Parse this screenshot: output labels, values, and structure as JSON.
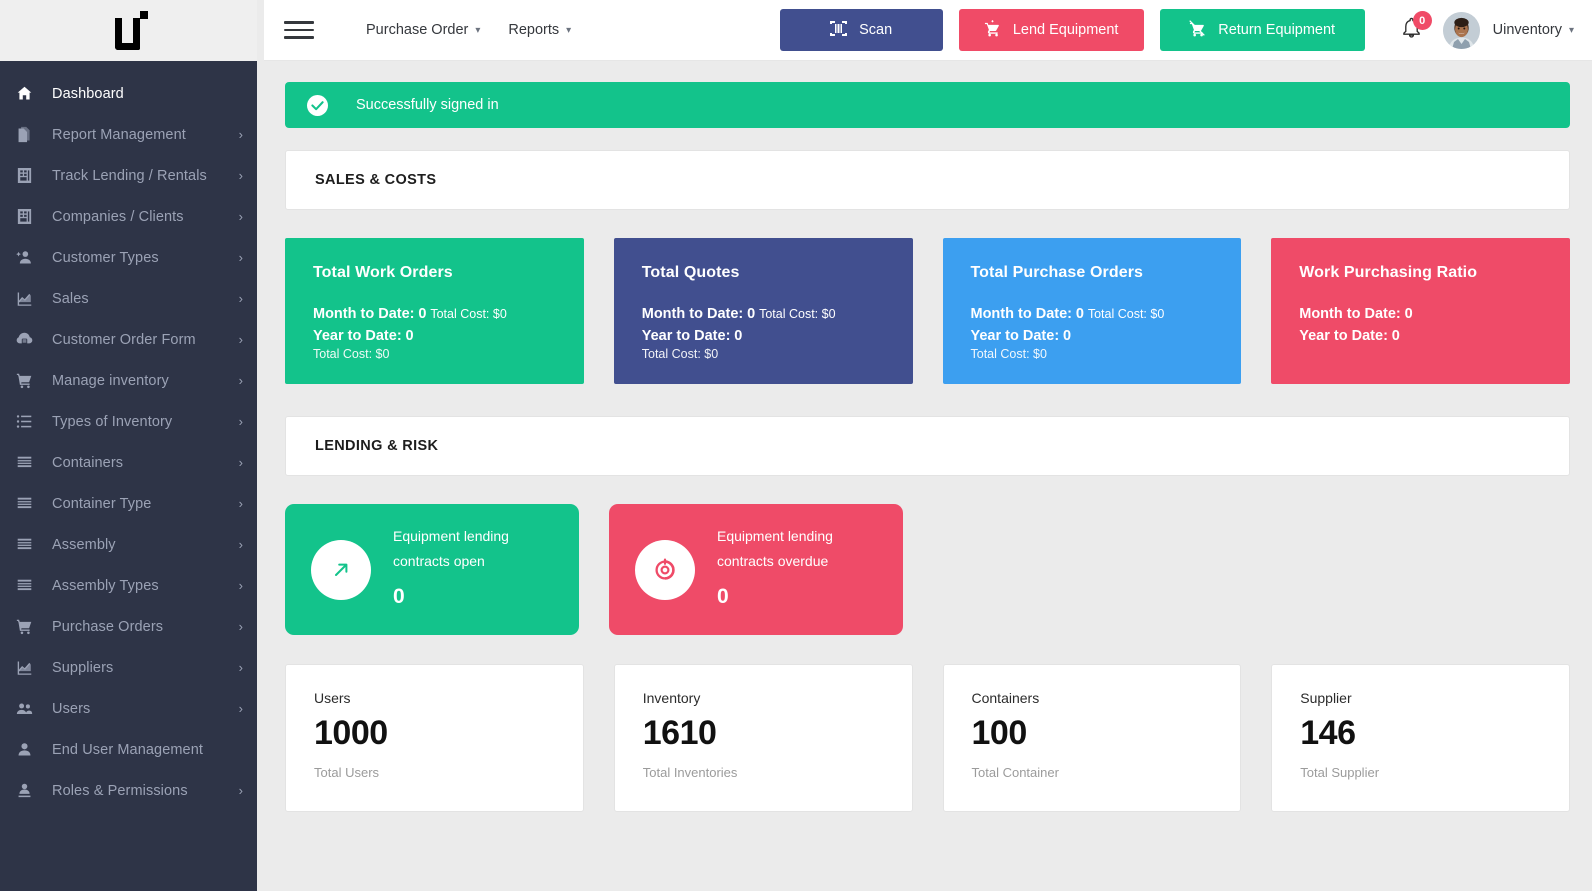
{
  "brand": {
    "logo_alt": "ui"
  },
  "sidebar": {
    "items": [
      {
        "label": "Dashboard",
        "icon": "home-icon",
        "caret": false,
        "active": true
      },
      {
        "label": "Report Management",
        "icon": "document-icon",
        "caret": true,
        "active": false
      },
      {
        "label": "Track Lending / Rentals",
        "icon": "building-icon",
        "caret": true,
        "active": false
      },
      {
        "label": "Companies / Clients",
        "icon": "building-icon",
        "caret": true,
        "active": false
      },
      {
        "label": "Customer Types",
        "icon": "person-add-icon",
        "caret": true,
        "active": false
      },
      {
        "label": "Sales",
        "icon": "chart-icon",
        "caret": true,
        "active": false
      },
      {
        "label": "Customer Order Form",
        "icon": "order-form-icon",
        "caret": true,
        "active": false
      },
      {
        "label": "Manage inventory",
        "icon": "cart-icon",
        "caret": true,
        "active": false
      },
      {
        "label": "Types of Inventory",
        "icon": "list-icon",
        "caret": true,
        "active": false
      },
      {
        "label": "Containers",
        "icon": "lines-icon",
        "caret": true,
        "active": false
      },
      {
        "label": "Container Type",
        "icon": "lines-icon",
        "caret": true,
        "active": false
      },
      {
        "label": "Assembly",
        "icon": "lines-icon",
        "caret": true,
        "active": false
      },
      {
        "label": "Assembly Types",
        "icon": "lines-icon",
        "caret": true,
        "active": false
      },
      {
        "label": "Purchase Orders",
        "icon": "cart-icon",
        "caret": true,
        "active": false
      },
      {
        "label": "Suppliers",
        "icon": "chart-icon",
        "caret": true,
        "active": false
      },
      {
        "label": "Users",
        "icon": "people-icon",
        "caret": true,
        "active": false
      },
      {
        "label": "End User Management",
        "icon": "person-icon",
        "caret": false,
        "active": false
      },
      {
        "label": "Roles & Permissions",
        "icon": "person-key-icon",
        "caret": true,
        "active": false
      }
    ]
  },
  "topbar": {
    "menu_icon": "hamburger-icon",
    "links": [
      {
        "label": "Purchase Order",
        "icon": "chevron-down-icon"
      },
      {
        "label": "Reports",
        "icon": "chevron-down-icon"
      }
    ],
    "buttons": [
      {
        "label": "Scan",
        "icon": "barcode-scan-icon",
        "color": "#414f8f"
      },
      {
        "label": "Lend Equipment",
        "icon": "cart-lend-icon",
        "color": "#f04b67"
      },
      {
        "label": "Return Equipment",
        "icon": "cart-return-icon",
        "color": "#13c38b"
      }
    ],
    "notifications": {
      "icon": "bell-icon",
      "count": "0",
      "badge_color": "#f04b67"
    },
    "avatar": {
      "icon": "avatar",
      "alt": "user avatar"
    },
    "user": {
      "name": "Uinventory",
      "caret_icon": "chevron-down-icon"
    }
  },
  "alert": {
    "message": "Successfully signed in",
    "icon": "check-circle-icon",
    "color": "#13c38b"
  },
  "sections": {
    "sales_costs": {
      "title": "SALES & COSTS"
    },
    "lending_risk": {
      "title": "LENDING & RISK"
    }
  },
  "kpi_cards": [
    {
      "title": "Total Work Orders",
      "color": "#13c38b",
      "mtd_label": "Month to Date:",
      "mtd_value": "0",
      "mtd_cost_label": "Total Cost: $0",
      "ytd_label": "Year to Date:",
      "ytd_value": "0",
      "ytd_cost_label": "Total Cost: $0"
    },
    {
      "title": "Total Quotes",
      "color": "#414f8f",
      "mtd_label": "Month to Date:",
      "mtd_value": "0",
      "mtd_cost_label": "Total Cost: $0",
      "ytd_label": "Year to Date:",
      "ytd_value": "0",
      "ytd_cost_label": "Total Cost: $0"
    },
    {
      "title": "Total Purchase Orders",
      "color": "#3c9ff0",
      "mtd_label": "Month to Date:",
      "mtd_value": "0",
      "mtd_cost_label": "Total Cost: $0",
      "ytd_label": "Year to Date:",
      "ytd_value": "0",
      "ytd_cost_label": "Total Cost: $0"
    },
    {
      "title": "Work Purchasing Ratio",
      "color": "#ef4b68",
      "mtd_label": "Month to Date:",
      "mtd_value": "0",
      "mtd_cost_label": "",
      "ytd_label": "Year to Date:",
      "ytd_value": "0",
      "ytd_cost_label": ""
    }
  ],
  "lending_cards": [
    {
      "text_line1": "Equipment lending",
      "text_line2": "contracts open",
      "value": "0",
      "color": "#13c38b",
      "icon": "arrow-up-right-icon",
      "icon_color": "#13c38b"
    },
    {
      "text_line1": "Equipment lending",
      "text_line2": "contracts overdue",
      "value": "0",
      "color": "#ef4b68",
      "icon": "overdue-clock-icon",
      "icon_color": "#ef4b68"
    }
  ],
  "stat_cards": [
    {
      "label": "Users",
      "value": "1000",
      "sub": "Total Users"
    },
    {
      "label": "Inventory",
      "value": "1610",
      "sub": "Total Inventories"
    },
    {
      "label": "Containers",
      "value": "100",
      "sub": "Total Container"
    },
    {
      "label": "Supplier",
      "value": "146",
      "sub": "Total Supplier"
    }
  ]
}
